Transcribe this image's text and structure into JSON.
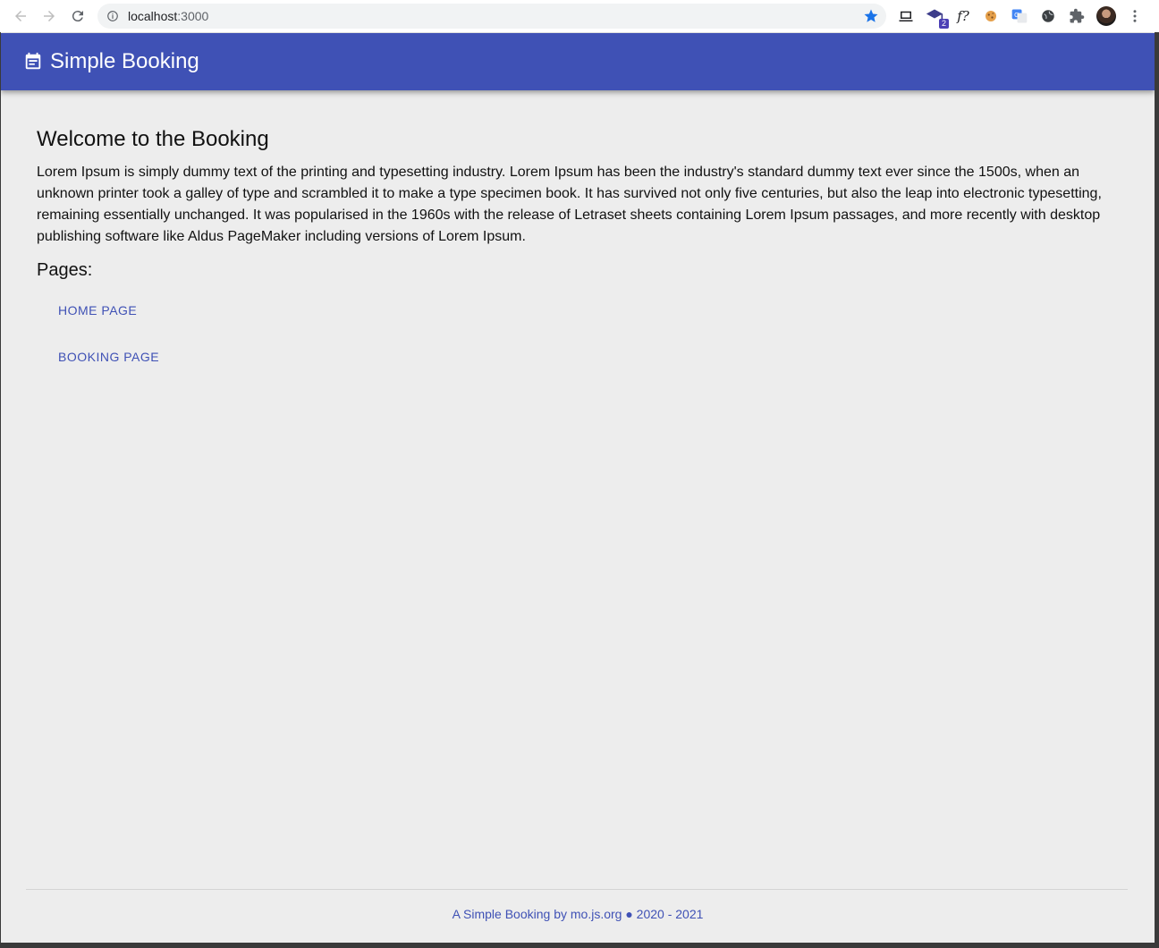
{
  "browser": {
    "url_host": "localhost",
    "url_port": ":3000",
    "extension_badge": "2",
    "fx_label": "f?"
  },
  "app": {
    "title": "Simple Booking"
  },
  "main": {
    "heading": "Welcome to the Booking",
    "body": "Lorem Ipsum is simply dummy text of the printing and typesetting industry. Lorem Ipsum has been the industry's standard dummy text ever since the 1500s, when an unknown printer took a galley of type and scrambled it to make a type specimen book. It has survived not only five centuries, but also the leap into electronic typesetting, remaining essentially unchanged. It was popularised in the 1960s with the release of Letraset sheets containing Lorem Ipsum passages, and more recently with desktop publishing software like Aldus PageMaker including versions of Lorem Ipsum.",
    "pages_heading": "Pages:",
    "links": [
      {
        "label": "HOME PAGE"
      },
      {
        "label": "BOOKING PAGE"
      }
    ]
  },
  "footer": {
    "text": "A Simple Booking by mo.js.org ● 2020 - 2021"
  },
  "colors": {
    "primary": "#3f51b5",
    "background": "#ededed"
  }
}
